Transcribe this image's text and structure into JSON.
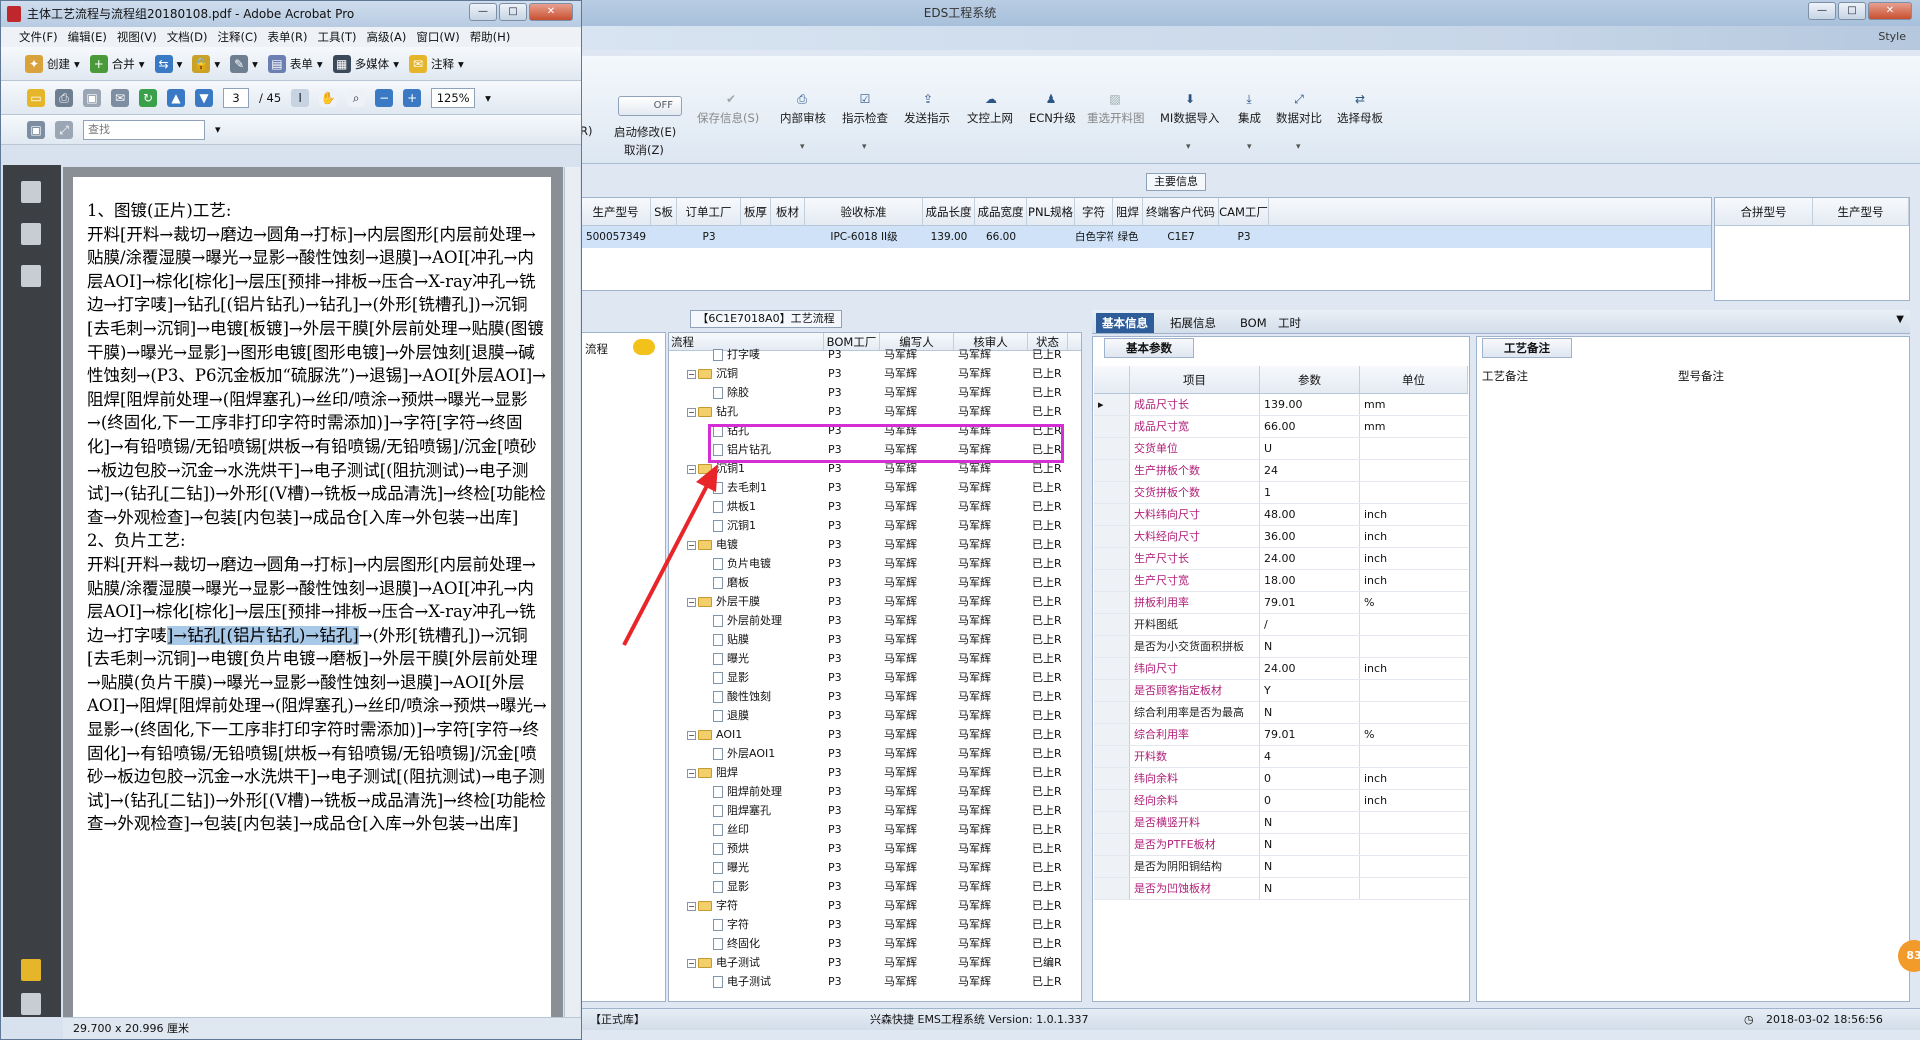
{
  "eds": {
    "title": "EDS工程系统",
    "style_label": "Style",
    "toggle_label": "OFF",
    "ribbon_left_fragment": "R)",
    "ribbon": [
      {
        "label": "启动修改(E)",
        "sub": "取消(Z)",
        "icon": "toggle-icon"
      },
      {
        "label": "保存信息(S)",
        "icon": "check-icon",
        "disabled": true
      },
      {
        "label": "内部审核",
        "icon": "printer-icon",
        "caret": true
      },
      {
        "label": "指示检查",
        "icon": "checklist-icon",
        "caret": true
      },
      {
        "label": "发送指示",
        "icon": "upload-icon"
      },
      {
        "label": "文控上网",
        "icon": "cloud-upload-icon"
      },
      {
        "label": "ECN升级",
        "icon": "people-icon"
      },
      {
        "label": "重选开料图",
        "icon": "image-icon",
        "disabled": true
      },
      {
        "label": "MI数据导入",
        "icon": "download-icon",
        "caret": true
      },
      {
        "label": "集成",
        "icon": "download-tray-icon",
        "caret": true
      },
      {
        "label": "数据对比",
        "icon": "compare-icon",
        "caret": true
      },
      {
        "label": "选择母板",
        "icon": "shuffle-icon"
      }
    ],
    "main_info_title": "主要信息",
    "main_grid": {
      "headers": [
        "生产型号",
        "S板",
        "订单工厂",
        "板厚",
        "板材",
        "验收标准",
        "成品长度",
        "成品宽度",
        "PNL规格",
        "字符",
        "阻焊",
        "终端客户代码",
        "CAM工厂"
      ],
      "row": [
        "500057349",
        "",
        "P3",
        "",
        "",
        "IPC-6018 II级",
        "139.00",
        "66.00",
        "",
        "白色字符",
        "绿色",
        "C1E7",
        "P3"
      ]
    },
    "merge_grid": {
      "headers": [
        "合拼型号",
        "生产型号"
      ]
    },
    "flow_panel": {
      "title": "【6C1E7018A0】工艺流程",
      "left_label": "流程",
      "headers": [
        "流程",
        "BOM工厂",
        "编写人",
        "核审人",
        "状态"
      ],
      "rows": [
        {
          "name": "打字唛",
          "level": 2,
          "type": "doc",
          "bom": "P3",
          "writer": "马军辉",
          "reviewer": "马军辉",
          "status": "已上R"
        },
        {
          "name": "沉铜",
          "level": 1,
          "type": "folder",
          "bom": "P3",
          "writer": "马军辉",
          "reviewer": "马军辉",
          "status": "已上R"
        },
        {
          "name": "除胶",
          "level": 2,
          "type": "doc",
          "bom": "P3",
          "writer": "马军辉",
          "reviewer": "马军辉",
          "status": "已上R"
        },
        {
          "name": "钻孔",
          "level": 1,
          "type": "folder",
          "bom": "P3",
          "writer": "马军辉",
          "reviewer": "马军辉",
          "status": "已上R"
        },
        {
          "name": "钻孔",
          "level": 2,
          "type": "doc",
          "bom": "P3",
          "writer": "马军辉",
          "reviewer": "马军辉",
          "status": "已上R"
        },
        {
          "name": "铝片钻孔",
          "level": 2,
          "type": "doc",
          "bom": "P3",
          "writer": "马军辉",
          "reviewer": "马军辉",
          "status": "已上R"
        },
        {
          "name": "沉铜1",
          "level": 1,
          "type": "folder",
          "bom": "P3",
          "writer": "马军辉",
          "reviewer": "马军辉",
          "status": "已上R"
        },
        {
          "name": "去毛刺1",
          "level": 2,
          "type": "doc",
          "bom": "P3",
          "writer": "马军辉",
          "reviewer": "马军辉",
          "status": "已上R"
        },
        {
          "name": "烘板1",
          "level": 2,
          "type": "doc",
          "bom": "P3",
          "writer": "马军辉",
          "reviewer": "马军辉",
          "status": "已上R"
        },
        {
          "name": "沉铜1",
          "level": 2,
          "type": "doc",
          "bom": "P3",
          "writer": "马军辉",
          "reviewer": "马军辉",
          "status": "已上R"
        },
        {
          "name": "电镀",
          "level": 1,
          "type": "folder",
          "bom": "P3",
          "writer": "马军辉",
          "reviewer": "马军辉",
          "status": "已上R"
        },
        {
          "name": "负片电镀",
          "level": 2,
          "type": "doc",
          "bom": "P3",
          "writer": "马军辉",
          "reviewer": "马军辉",
          "status": "已上R"
        },
        {
          "name": "磨板",
          "level": 2,
          "type": "doc",
          "bom": "P3",
          "writer": "马军辉",
          "reviewer": "马军辉",
          "status": "已上R"
        },
        {
          "name": "外层干膜",
          "level": 1,
          "type": "folder",
          "bom": "P3",
          "writer": "马军辉",
          "reviewer": "马军辉",
          "status": "已上R"
        },
        {
          "name": "外层前处理",
          "level": 2,
          "type": "doc",
          "bom": "P3",
          "writer": "马军辉",
          "reviewer": "马军辉",
          "status": "已上R"
        },
        {
          "name": "贴膜",
          "level": 2,
          "type": "doc",
          "bom": "P3",
          "writer": "马军辉",
          "reviewer": "马军辉",
          "status": "已上R"
        },
        {
          "name": "曝光",
          "level": 2,
          "type": "doc",
          "bom": "P3",
          "writer": "马军辉",
          "reviewer": "马军辉",
          "status": "已上R"
        },
        {
          "name": "显影",
          "level": 2,
          "type": "doc",
          "bom": "P3",
          "writer": "马军辉",
          "reviewer": "马军辉",
          "status": "已上R"
        },
        {
          "name": "酸性蚀刻",
          "level": 2,
          "type": "doc",
          "bom": "P3",
          "writer": "马军辉",
          "reviewer": "马军辉",
          "status": "已上R"
        },
        {
          "name": "退膜",
          "level": 2,
          "type": "doc",
          "bom": "P3",
          "writer": "马军辉",
          "reviewer": "马军辉",
          "status": "已上R"
        },
        {
          "name": "AOI1",
          "level": 1,
          "type": "folder",
          "bom": "P3",
          "writer": "马军辉",
          "reviewer": "马军辉",
          "status": "已上R"
        },
        {
          "name": "外层AOI1",
          "level": 2,
          "type": "doc",
          "bom": "P3",
          "writer": "马军辉",
          "reviewer": "马军辉",
          "status": "已上R"
        },
        {
          "name": "阻焊",
          "level": 1,
          "type": "folder",
          "bom": "P3",
          "writer": "马军辉",
          "reviewer": "马军辉",
          "status": "已上R"
        },
        {
          "name": "阻焊前处理",
          "level": 2,
          "type": "doc",
          "bom": "P3",
          "writer": "马军辉",
          "reviewer": "马军辉",
          "status": "已上R"
        },
        {
          "name": "阻焊塞孔",
          "level": 2,
          "type": "doc",
          "bom": "P3",
          "writer": "马军辉",
          "reviewer": "马军辉",
          "status": "已上R"
        },
        {
          "name": "丝印",
          "level": 2,
          "type": "doc",
          "bom": "P3",
          "writer": "马军辉",
          "reviewer": "马军辉",
          "status": "已上R"
        },
        {
          "name": "预烘",
          "level": 2,
          "type": "doc",
          "bom": "P3",
          "writer": "马军辉",
          "reviewer": "马军辉",
          "status": "已上R"
        },
        {
          "name": "曝光",
          "level": 2,
          "type": "doc",
          "bom": "P3",
          "writer": "马军辉",
          "reviewer": "马军辉",
          "status": "已上R"
        },
        {
          "name": "显影",
          "level": 2,
          "type": "doc",
          "bom": "P3",
          "writer": "马军辉",
          "reviewer": "马军辉",
          "status": "已上R"
        },
        {
          "name": "字符",
          "level": 1,
          "type": "folder",
          "bom": "P3",
          "writer": "马军辉",
          "reviewer": "马军辉",
          "status": "已上R"
        },
        {
          "name": "字符",
          "level": 2,
          "type": "doc",
          "bom": "P3",
          "writer": "马军辉",
          "reviewer": "马军辉",
          "status": "已上R"
        },
        {
          "name": "终固化",
          "level": 2,
          "type": "doc",
          "bom": "P3",
          "writer": "马军辉",
          "reviewer": "马军辉",
          "status": "已上R"
        },
        {
          "name": "电子测试",
          "level": 1,
          "type": "folder",
          "bom": "P3",
          "writer": "马军辉",
          "reviewer": "马军辉",
          "status": "已编R"
        },
        {
          "name": "电子测试",
          "level": 2,
          "type": "doc",
          "bom": "P3",
          "writer": "马军辉",
          "reviewer": "马军辉",
          "status": "已上R"
        }
      ]
    },
    "right_tabs": [
      "基本信息",
      "拓展信息",
      "BOM",
      "工时"
    ],
    "params": {
      "title": "基本参数",
      "headers": [
        "项目",
        "参数",
        "单位"
      ],
      "rows": [
        {
          "name": "成品尺寸长",
          "value": "139.00",
          "unit": "mm",
          "pink": true
        },
        {
          "name": "成品尺寸宽",
          "value": "66.00",
          "unit": "mm",
          "pink": true
        },
        {
          "name": "交货单位",
          "value": "U",
          "unit": "",
          "pink": true
        },
        {
          "name": "生产拼板个数",
          "value": "24",
          "unit": "",
          "pink": true
        },
        {
          "name": "交货拼板个数",
          "value": "1",
          "unit": "",
          "pink": true
        },
        {
          "name": "大料纬向尺寸",
          "value": "48.00",
          "unit": "inch",
          "pink": true
        },
        {
          "name": "大料经向尺寸",
          "value": "36.00",
          "unit": "inch",
          "pink": true
        },
        {
          "name": "生产尺寸长",
          "value": "24.00",
          "unit": "inch",
          "pink": true
        },
        {
          "name": "生产尺寸宽",
          "value": "18.00",
          "unit": "inch",
          "pink": true
        },
        {
          "name": "拼板利用率",
          "value": "79.01",
          "unit": "%",
          "pink": true
        },
        {
          "name": "开料图纸",
          "value": "/",
          "unit": "",
          "pink": false
        },
        {
          "name": "是否为小交货面积拼板",
          "value": "N",
          "unit": "",
          "pink": false
        },
        {
          "name": "纬向尺寸",
          "value": "24.00",
          "unit": "inch",
          "pink": true
        },
        {
          "name": "是否顾客指定板材",
          "value": "Y",
          "unit": "",
          "pink": true
        },
        {
          "name": "综合利用率是否为最高",
          "value": "N",
          "unit": "",
          "pink": false
        },
        {
          "name": "综合利用率",
          "value": "79.01",
          "unit": "%",
          "pink": true
        },
        {
          "name": "开料数",
          "value": "4",
          "unit": "",
          "pink": true
        },
        {
          "name": "纬向余料",
          "value": "0",
          "unit": "inch",
          "pink": true
        },
        {
          "name": "经向余料",
          "value": "0",
          "unit": "inch",
          "pink": true
        },
        {
          "name": "是否横竖开料",
          "value": "N",
          "unit": "",
          "pink": true
        },
        {
          "name": "是否为PTFE板材",
          "value": "N",
          "unit": "",
          "pink": true
        },
        {
          "name": "是否为阴阳铜结构",
          "value": "N",
          "unit": "",
          "pink": false
        },
        {
          "name": "是否为凹蚀板材",
          "value": "N",
          "unit": "",
          "pink": true
        }
      ]
    },
    "notes": {
      "title": "工艺备注",
      "col1": "工艺备注",
      "col2": "型号备注"
    },
    "status": {
      "left": "【正式库】",
      "center": "兴森快捷 EMS工程系统 Version: 1.0.1.337",
      "right": "2018-03-02 18:56:56"
    },
    "badge": "83"
  },
  "acrobat": {
    "title": "主体工艺流程与流程组20180108.pdf - Adobe Acrobat Pro",
    "menu": [
      "文件(F)",
      "编辑(E)",
      "视图(V)",
      "文档(D)",
      "注释(C)",
      "表单(R)",
      "工具(T)",
      "高级(A)",
      "窗口(W)",
      "帮助(H)"
    ],
    "toolbar1": [
      "创建",
      "合并",
      "表单",
      "多媒体",
      "注释"
    ],
    "page_current": "3",
    "page_total": "/ 45",
    "zoom": "125%",
    "search_placeholder": "查找",
    "doc_text_before": "1、图镀(正片)工艺:\n开料[开料→裁切→磨边→圆角→打标]→内层图形[内层前处理→贴膜/涂覆湿膜→曝光→显影→酸性蚀刻→退膜]→AOI[冲孔→内层AOI]→棕化[棕化]→层压[预排→排板→压合→X-ray冲孔→铣边→打字唛]→钻孔[(铝片钻孔)→钻孔]→(外形[铣槽孔])→沉铜[去毛刺→沉铜]→电镀[板镀]→外层干膜[外层前处理→贴膜(图镀干膜)→曝光→显影]→图形电镀[图形电镀]→外层蚀刻[退膜→碱性蚀刻→(P3、P6沉金板加“硫脲洗”)→退锡]→AOI[外层AOI]→阻焊[阻焊前处理→(阻焊塞孔)→丝印/喷涂→预烘→曝光→显影→(终固化,下一工序非打印字符时需添加)]→字符[字符→终固化]→有铅喷锡/无铅喷锡[烘板→有铅喷锡/无铅喷锡]/沉金[喷砂→板边包胶→沉金→水洗烘干]→电子测试[(阻抗测试)→电子测试]→(钻孔[二钻])→外形[(V槽)→铣板→成品清洗]→终检[功能检查→外观检查]→包装[内包装]→成品仓[入库→外包装→出库]\n2、负片工艺:\n开料[开料→裁切→磨边→圆角→打标]→内层图形[内层前处理→贴膜/涂覆湿膜→曝光→显影→酸性蚀刻→退膜]→AOI[冲孔→内层AOI]→棕化[棕化]→层压[预排→排板→压合→X-ray冲孔→铣边→打字唛",
    "doc_text_selected": "]→钻孔[(铝片钻孔)→钻孔]",
    "doc_text_after": "→(外形[铣槽孔])→沉铜[去毛刺→沉铜]→电镀[负片电镀→磨板]→外层干膜[外层前处理→贴膜(负片干膜)→曝光→显影→酸性蚀刻→退膜]→AOI[外层AOI]→阻焊[阻焊前处理→(阻焊塞孔)→丝印/喷涂→预烘→曝光→显影→(终固化,下一工序非打印字符时需添加)]→字符[字符→终固化]→有铅喷锡/无铅喷锡[烘板→有铅喷锡/无铅喷锡]/沉金[喷砂→板边包胶→沉金→水洗烘干]→电子测试[(阻抗测试)→电子测试]→(钻孔[二钻])→外形[(V槽)→铣板→成品清洗]→终检[功能检查→外观检查]→包装[内包装]→成品仓[入库→外包装→出库]",
    "status": "29.700 x 20.996 厘米"
  }
}
